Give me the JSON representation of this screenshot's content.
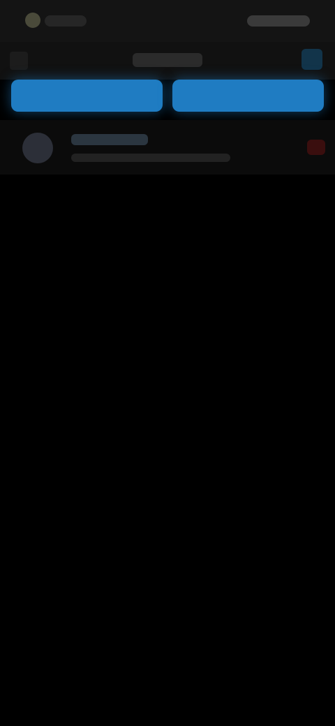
{
  "status_bar": {
    "left_text": "",
    "right_text": ""
  },
  "header": {
    "title": "",
    "back_icon": "back-arrow-icon",
    "action_icon": "search-icon"
  },
  "buttons": [
    {
      "label": ""
    },
    {
      "label": ""
    }
  ],
  "list": {
    "items": [
      {
        "title": "",
        "subtitle": "",
        "avatar_icon": "user-avatar-icon",
        "badge_icon": "badge-icon"
      }
    ]
  },
  "colors": {
    "background": "#000000",
    "accent": "#1f7cc2",
    "badge": "#3a0e0e"
  }
}
